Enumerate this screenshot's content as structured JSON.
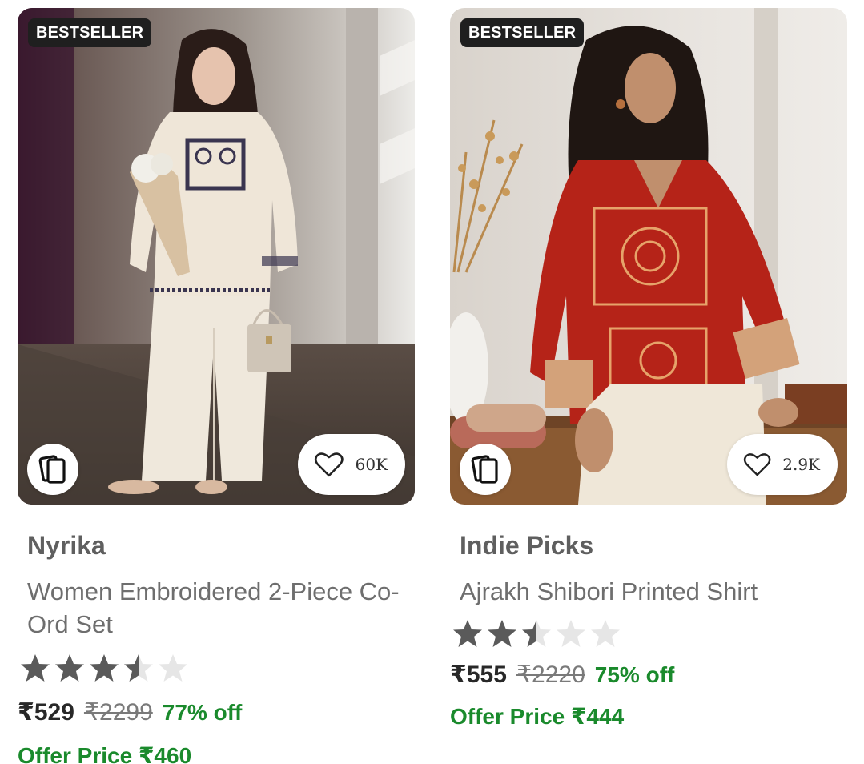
{
  "colors": {
    "badge_bg": "#1f1f1f",
    "price_green": "#1a8a2c",
    "star_filled": "#5a5a5a",
    "star_empty": "#e6e6e6"
  },
  "products": [
    {
      "badge": "BESTSELLER",
      "wishlist_count": "60K",
      "brand": "Nyrika",
      "title": "Women Embroidered 2-Piece Co-Ord Set",
      "rating": 3.5,
      "price": "₹529",
      "mrp": "₹2299",
      "discount": "77% off",
      "offer_price": "Offer Price ₹460",
      "image_icon": "product-photo"
    },
    {
      "badge": "BESTSELLER",
      "wishlist_count": "2.9K",
      "brand": "Indie Picks",
      "title": "Ajrakh Shibori Printed Shirt",
      "rating": 2.5,
      "price": "₹555",
      "mrp": "₹2220",
      "discount": "75% off",
      "offer_price": "Offer Price ₹444",
      "image_icon": "product-photo"
    }
  ],
  "icons": {
    "similar": "similar-products-icon",
    "wishlist": "heart-icon",
    "rating": "star-icon"
  }
}
